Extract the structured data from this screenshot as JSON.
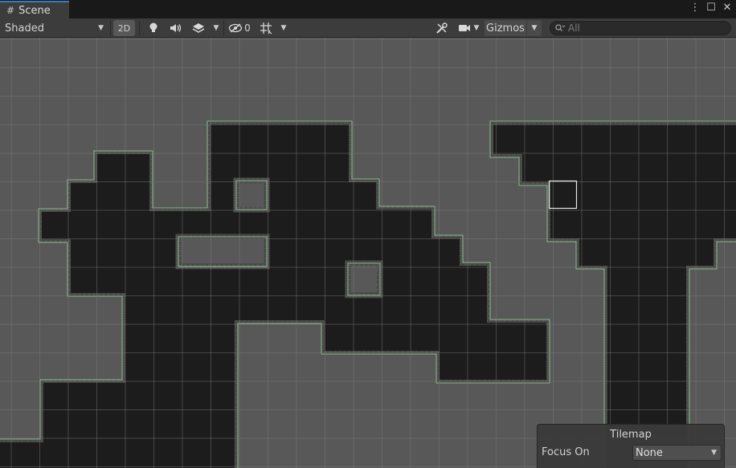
{
  "tab": {
    "title": "Scene",
    "icon": "grid-hash-icon"
  },
  "window_actions": {
    "menu": "⋮",
    "maximize": "☐",
    "close": "✕"
  },
  "toolbar": {
    "shading_mode": "Shaded",
    "btn_2d": "2D",
    "hidden_count": "0",
    "gizmos_label": "Gizmos",
    "search_placeholder": "All"
  },
  "overlay": {
    "title": "Tilemap",
    "focus_label": "Focus On",
    "focus_value": "None"
  },
  "colors": {
    "accent_tab": "#3a79bb",
    "empty_tile": "#585858",
    "wall_tile": "#1c1c1c",
    "grid_line": "#6a6a6a",
    "tile_outline": "#8cb98c"
  }
}
